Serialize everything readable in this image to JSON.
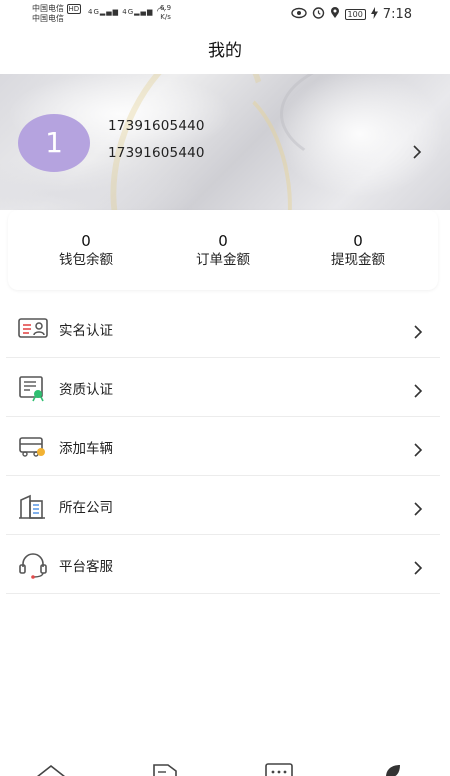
{
  "status_bar": {
    "carrier_1": "中国电信",
    "carrier_2": "中国电信",
    "hd_badge": "HD",
    "network_1": "4G",
    "network_2": "4G",
    "speed_value": "6.9",
    "speed_unit": "K/s",
    "battery": "100",
    "time": "7:18"
  },
  "header": {
    "title": "我的"
  },
  "profile": {
    "avatar_text": "1",
    "line_1": "17391605440",
    "line_2": "17391605440"
  },
  "stats": [
    {
      "value": "0",
      "label": "钱包余额"
    },
    {
      "value": "0",
      "label": "订单金额"
    },
    {
      "value": "0",
      "label": "提现金额"
    }
  ],
  "menu": [
    {
      "label": "实名认证",
      "icon": "id-card-icon"
    },
    {
      "label": "资质认证",
      "icon": "certificate-icon"
    },
    {
      "label": "添加车辆",
      "icon": "vehicle-icon"
    },
    {
      "label": "所在公司",
      "icon": "building-icon"
    },
    {
      "label": "平台客服",
      "icon": "headset-icon"
    }
  ],
  "bottom_nav": {
    "items": [
      "home-icon",
      "document-icon",
      "chat-icon",
      "profile-icon"
    ]
  },
  "colors": {
    "avatar": "#b5a3df",
    "accent_red": "#e34a4a",
    "accent_green": "#2fbf71",
    "icon_gray": "#555555"
  }
}
